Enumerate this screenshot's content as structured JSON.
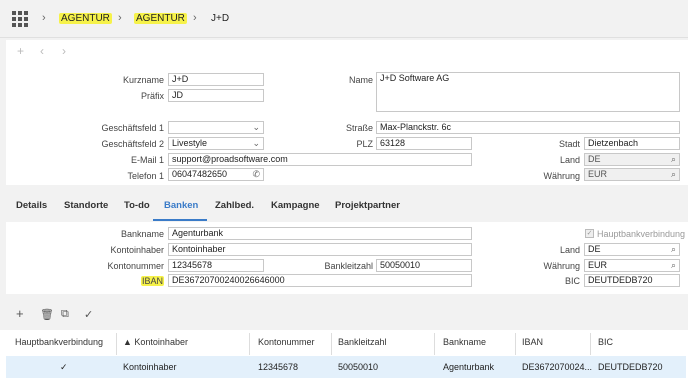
{
  "breadcrumb": {
    "items": [
      "AGENTUR",
      "AGENTUR",
      "J+D"
    ]
  },
  "toolbar_top": {
    "add": "+",
    "back": "‹",
    "forward": "›"
  },
  "form": {
    "kurzname": {
      "label": "Kurzname",
      "value": "J+D"
    },
    "praefix": {
      "label": "Präfix",
      "value": "JD"
    },
    "name": {
      "label": "Name",
      "value": "J+D Software AG"
    },
    "geschaeftsfeld1": {
      "label": "Geschäftsfeld 1",
      "value": ""
    },
    "geschaeftsfeld2": {
      "label": "Geschäftsfeld 2",
      "value": "Livestyle"
    },
    "email": {
      "label": "E-Mail 1",
      "value": "support@proadsoftware.com"
    },
    "telefon": {
      "label": "Telefon 1",
      "value": "06047482650"
    },
    "strasse": {
      "label": "Straße",
      "value": "Max-Planckstr. 6c"
    },
    "plz": {
      "label": "PLZ",
      "value": "63128"
    },
    "stadt": {
      "label": "Stadt",
      "value": "Dietzenbach"
    },
    "land": {
      "label": "Land",
      "value": "DE"
    },
    "waehrung": {
      "label": "Währung",
      "value": "EUR"
    }
  },
  "tabs": [
    "Details",
    "Standorte",
    "To-do",
    "Banken",
    "Zahlbed.",
    "Kampagne",
    "Projektpartner"
  ],
  "active_tab": "Banken",
  "bank": {
    "bankname": {
      "label": "Bankname",
      "value": "Agenturbank"
    },
    "kontoinhaber": {
      "label": "Kontoinhaber",
      "value": "Kontoinhaber"
    },
    "kontonummer": {
      "label": "Kontonummer",
      "value": "12345678"
    },
    "bankleitzahl": {
      "label": "Bankleitzahl",
      "value": "50050010"
    },
    "iban": {
      "label": "IBAN",
      "value": "DE36720700240026646000"
    },
    "hauptbank": {
      "label": "Hauptbankverbindung",
      "checked": true
    },
    "land": {
      "label": "Land",
      "value": "DE"
    },
    "waehrung": {
      "label": "Währung",
      "value": "EUR"
    },
    "bic": {
      "label": "BIC",
      "value": "DEUTDEDB720"
    }
  },
  "table": {
    "columns": [
      "Hauptbankverbindung",
      "▲ Kontoinhaber",
      "Kontonummer",
      "Bankleitzahl",
      "Bankname",
      "IBAN",
      "BIC"
    ],
    "rows": [
      [
        "✓",
        "Kontoinhaber",
        "12345678",
        "50050010",
        "Agenturbank",
        "DE3672070024...",
        "DEUTDEDB720"
      ]
    ]
  },
  "colors": {
    "accent": "#3a7bc8",
    "highlight": "#f6f24a",
    "selected_row": "#e3f0fb"
  }
}
